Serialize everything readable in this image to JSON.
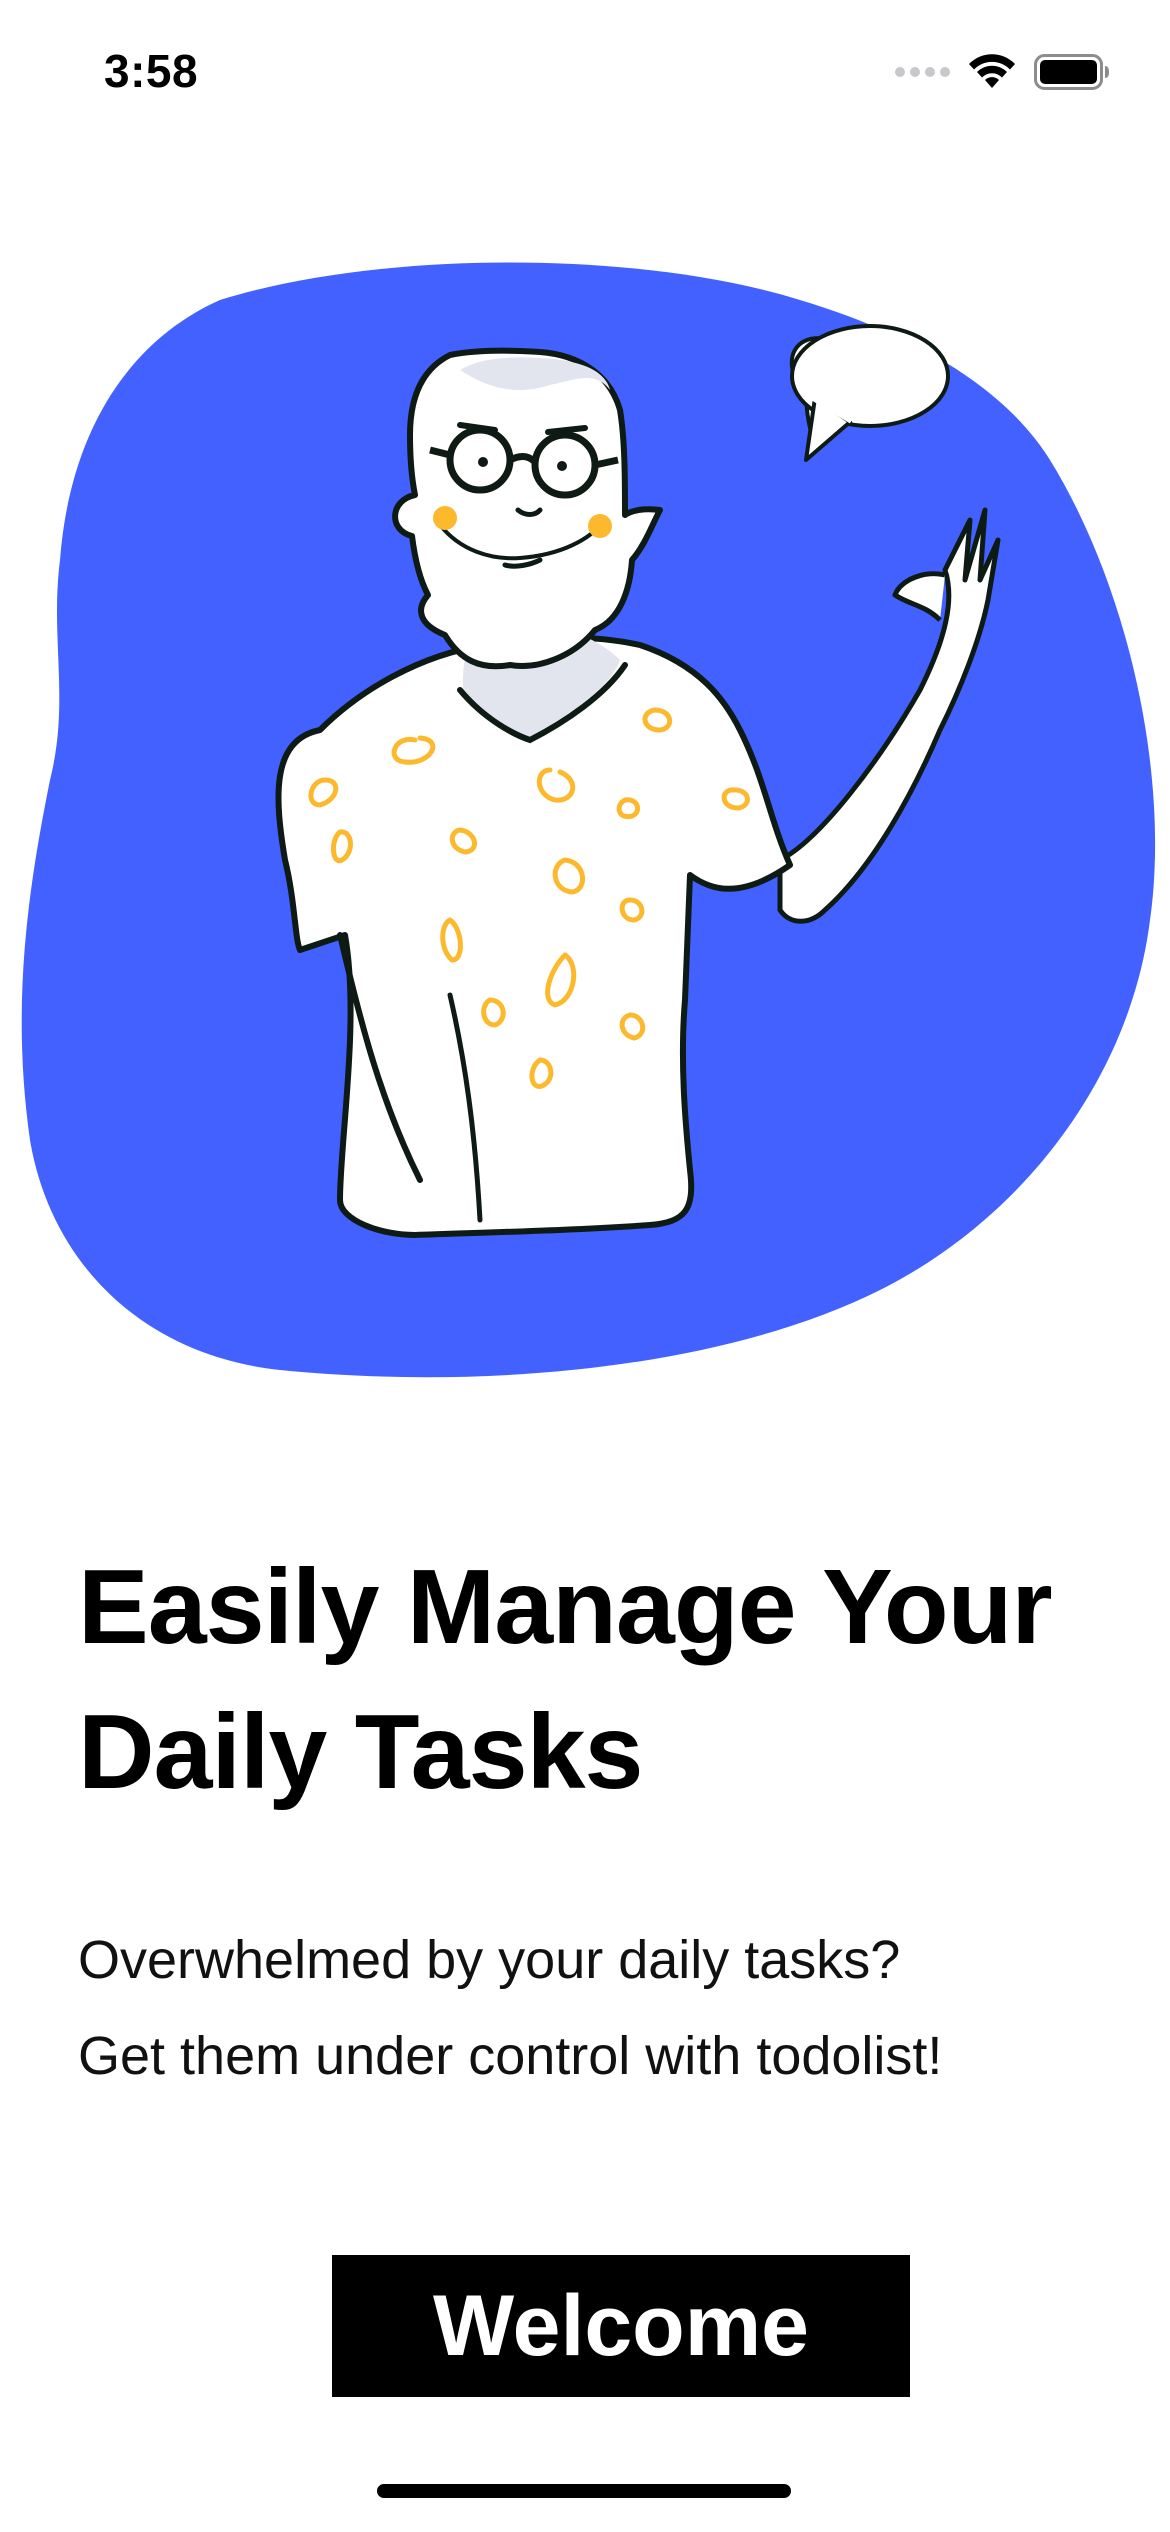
{
  "status_bar": {
    "time": "3:58",
    "icons": [
      "cellular-signal-icon",
      "wifi-icon",
      "battery-icon"
    ]
  },
  "illustration": {
    "subject": "person-waving-illustration",
    "colors": {
      "blob": "#4361FF",
      "outline": "#0E1A14",
      "shirt_pattern": "#FDB92E",
      "cheeks": "#FDB92E",
      "skin": "#FFFFFF",
      "hair_shade": "#DDE0EA"
    }
  },
  "onboarding": {
    "headline_line1": "Easily Manage Your",
    "headline_line2": "Daily Tasks",
    "subtitle_line1": "Overwhelmed by your daily tasks?",
    "subtitle_line2": "Get them under control with todolist!"
  },
  "actions": {
    "welcome_label": "Welcome"
  },
  "theme": {
    "button_bg": "#000000",
    "button_text": "#FFFFFF",
    "background": "#FFFFFF"
  }
}
